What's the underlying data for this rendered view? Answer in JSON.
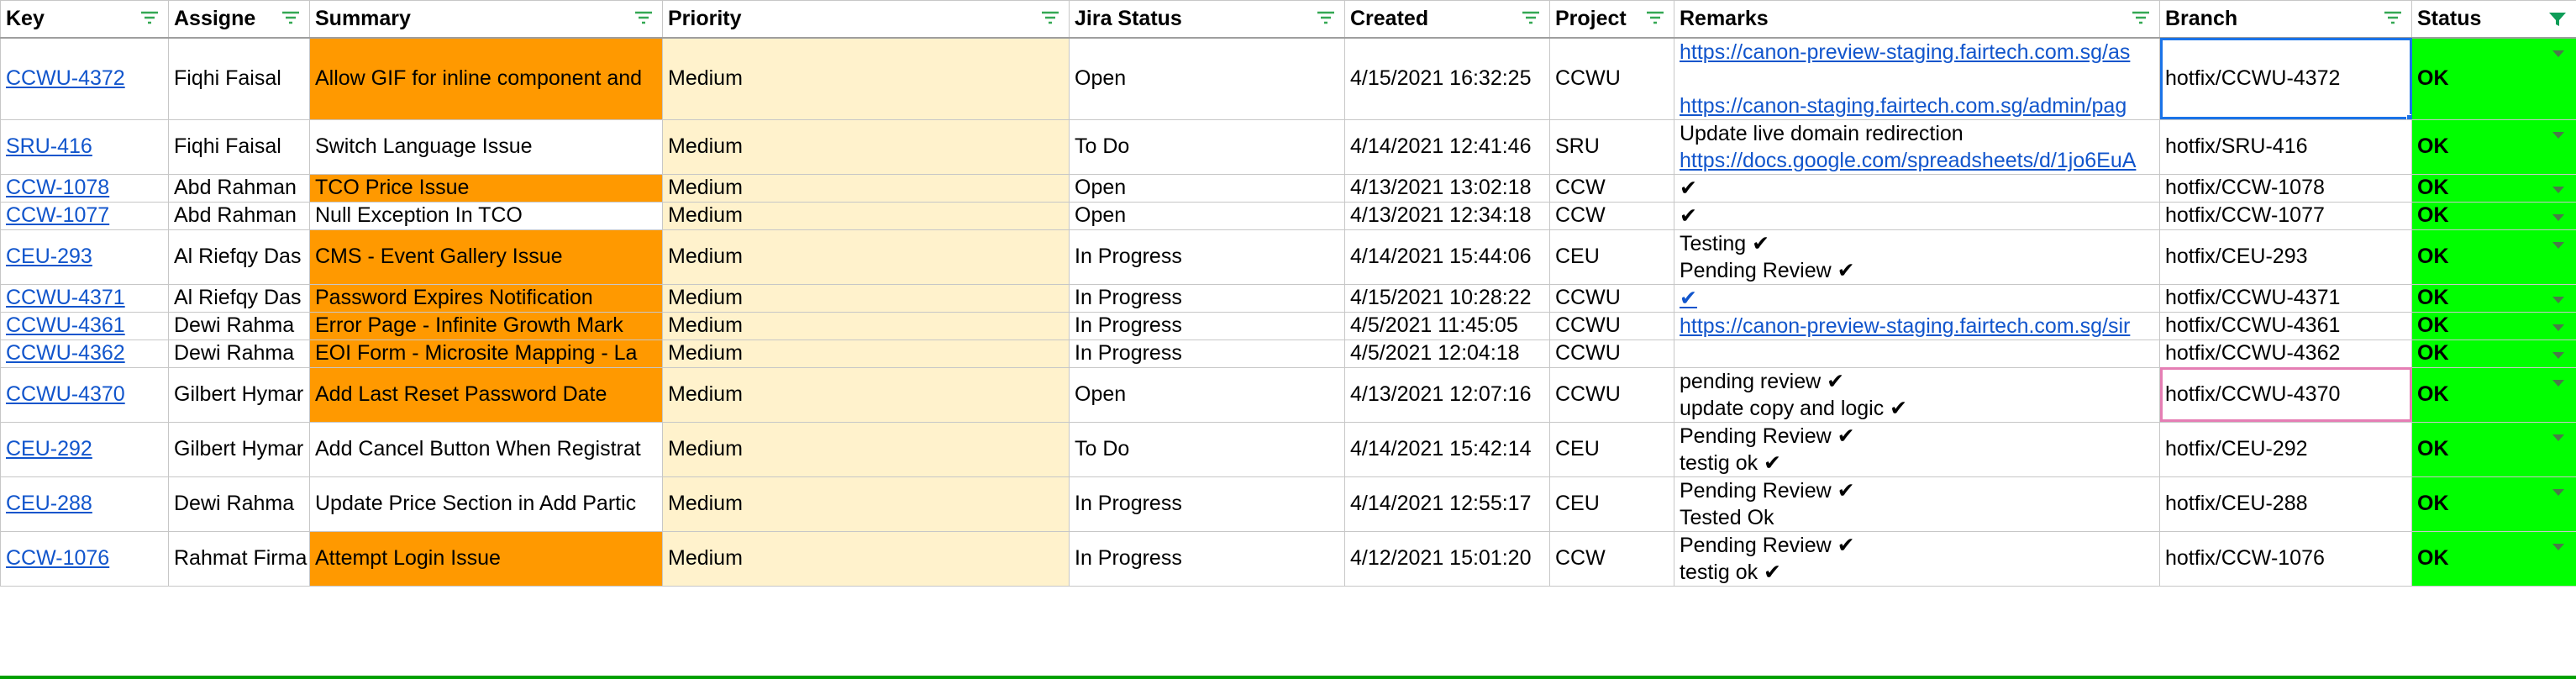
{
  "headers": {
    "key": "Key",
    "assignee": "Assigne",
    "summary": "Summary",
    "priority": "Priority",
    "jira_status": "Jira Status",
    "created": "Created",
    "project": "Project",
    "remarks": "Remarks",
    "branch": "Branch",
    "status": "Status"
  },
  "colors": {
    "orange": "#ff9900",
    "cream": "#fff2cc",
    "green": "#00ff00",
    "link": "#1155cc",
    "active_filter": "#0f9d58"
  },
  "rows": [
    {
      "key": "CCWU-4372",
      "assignee": "Fiqhi Faisal",
      "summary": "Allow GIF for inline component and",
      "priority": "Medium",
      "jira_status": "Open",
      "created": "4/15/2021 16:32:25",
      "project": "CCWU",
      "remarks": [
        "https://canon-preview-staging.fairtech.com.sg/as",
        "",
        "https://canon-staging.fairtech.com.sg/admin/pag"
      ],
      "branch": "hotfix/CCWU-4372",
      "status": "OK"
    },
    {
      "key": "SRU-416",
      "assignee": "Fiqhi Faisal",
      "summary": "Switch Language Issue",
      "priority": "Medium",
      "jira_status": "To Do",
      "created": "4/14/2021 12:41:46",
      "project": "SRU",
      "remarks": [
        "Update live domain redirection",
        "https://docs.google.com/spreadsheets/d/1jo6EuA"
      ],
      "branch": "hotfix/SRU-416",
      "status": "OK"
    },
    {
      "key": "CCW-1078",
      "assignee": "Abd Rahman",
      "summary": "TCO Price Issue",
      "priority": "Medium",
      "jira_status": "Open",
      "created": "4/13/2021 13:02:18",
      "project": "CCW",
      "remarks": [
        "✔"
      ],
      "branch": "hotfix/CCW-1078",
      "status": "OK"
    },
    {
      "key": "CCW-1077",
      "assignee": "Abd Rahman",
      "summary": "Null Exception In TCO",
      "priority": "Medium",
      "jira_status": "Open",
      "created": "4/13/2021 12:34:18",
      "project": "CCW",
      "remarks": [
        "✔"
      ],
      "branch": "hotfix/CCW-1077",
      "status": "OK"
    },
    {
      "key": "CEU-293",
      "assignee": "Al Riefqy Das",
      "summary": "CMS - Event Gallery Issue",
      "priority": "Medium",
      "jira_status": "In Progress",
      "created": "4/14/2021 15:44:06",
      "project": "CEU",
      "remarks": [
        "Testing  ✔",
        "Pending Review  ✔"
      ],
      "branch": "hotfix/CEU-293",
      "status": "OK"
    },
    {
      "key": "CCWU-4371",
      "assignee": "Al Riefqy Das",
      "summary": "Password Expires Notification",
      "priority": "Medium",
      "jira_status": "In Progress",
      "created": "4/15/2021 10:28:22",
      "project": "CCWU",
      "remarks": [
        "✔"
      ],
      "branch": "hotfix/CCWU-4371",
      "status": "OK"
    },
    {
      "key": "CCWU-4361",
      "assignee": "Dewi Rahma",
      "summary": "Error Page - Infinite Growth Mark",
      "priority": "Medium",
      "jira_status": "In Progress",
      "created": "4/5/2021 11:45:05",
      "project": "CCWU",
      "remarks": [
        "https://canon-preview-staging.fairtech.com.sg/sir"
      ],
      "branch": "hotfix/CCWU-4361",
      "status": "OK"
    },
    {
      "key": "CCWU-4362",
      "assignee": "Dewi Rahma",
      "summary": "EOI Form - Microsite Mapping - La",
      "priority": "Medium",
      "jira_status": "In Progress",
      "created": "4/5/2021 12:04:18",
      "project": "CCWU",
      "remarks": [
        ""
      ],
      "branch": "hotfix/CCWU-4362",
      "status": "OK"
    },
    {
      "key": "CCWU-4370",
      "assignee": "Gilbert Hymar",
      "summary": "Add Last Reset Password Date",
      "priority": "Medium",
      "jira_status": "Open",
      "created": "4/13/2021 12:07:16",
      "project": "CCWU",
      "remarks": [
        "pending review ✔",
        "update copy and logic ✔"
      ],
      "branch": "hotfix/CCWU-4370",
      "status": "OK"
    },
    {
      "key": "CEU-292",
      "assignee": "Gilbert Hymar",
      "summary": "Add Cancel Button When Registrat",
      "priority": "Medium",
      "jira_status": "To Do",
      "created": "4/14/2021 15:42:14",
      "project": "CEU",
      "remarks": [
        "Pending Review ✔",
        "testig ok ✔"
      ],
      "branch": "hotfix/CEU-292",
      "status": "OK"
    },
    {
      "key": "CEU-288",
      "assignee": "Dewi Rahma",
      "summary": "Update Price Section in Add Partic",
      "priority": "Medium",
      "jira_status": "In Progress",
      "created": "4/14/2021 12:55:17",
      "project": "CEU",
      "remarks": [
        "Pending Review ✔",
        "Tested Ok"
      ],
      "branch": "hotfix/CEU-288",
      "status": "OK"
    },
    {
      "key": "CCW-1076",
      "assignee": "Rahmat Firma",
      "summary": "Attempt Login Issue",
      "priority": "Medium",
      "jira_status": "In Progress",
      "created": "4/12/2021 15:01:20",
      "project": "CCW",
      "remarks": [
        "Pending Review ✔",
        "testig ok ✔"
      ],
      "branch": "hotfix/CCW-1076",
      "status": "OK"
    }
  ]
}
